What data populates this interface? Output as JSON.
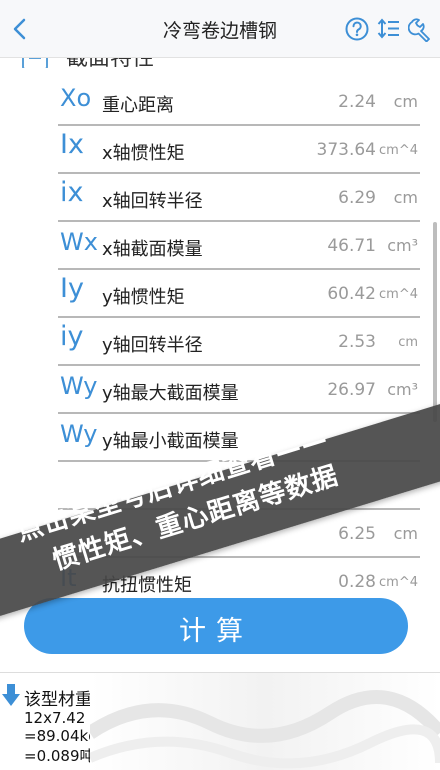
{
  "header": {
    "title": "冷弯卷边槽钢"
  },
  "section": {
    "label": "截面特性"
  },
  "properties": [
    {
      "symbol": "Xo",
      "label": "重心距离",
      "value": "2.24",
      "unit": "cm"
    },
    {
      "symbol": "Ix",
      "label": "x轴惯性矩",
      "value": "373.64",
      "unit": "cm^4"
    },
    {
      "symbol": "ix",
      "label": "x轴回转半径",
      "value": "6.29",
      "unit": "cm"
    },
    {
      "symbol": "Wx",
      "label": "x轴截面模量",
      "value": "46.71",
      "unit": "cm³"
    },
    {
      "symbol": "Iy",
      "label": "y轴惯性矩",
      "value": "60.42",
      "unit": "cm^4"
    },
    {
      "symbol": "iy",
      "label": "y轴回转半径",
      "value": "2.53",
      "unit": "cm"
    },
    {
      "symbol": "Wy",
      "label": "y轴最大截面模量",
      "value": "26.97",
      "unit": "cm³"
    },
    {
      "symbol": "Wy",
      "label": "y轴最小截面模量",
      "value": "",
      "unit": ""
    },
    {
      "symbol": "",
      "label": "",
      "value": "",
      "unit": ""
    },
    {
      "symbol": "",
      "label": "",
      "value": "6.25",
      "unit": "cm"
    },
    {
      "symbol": "It",
      "label": "抗扭惯性矩",
      "value": "0.28",
      "unit": "cm^4"
    }
  ],
  "calculate_button": "计算",
  "result": {
    "line0": "该型材重量",
    "line1": "12x7.42",
    "line2": "=89.04kg",
    "line3": "=0.089吨"
  },
  "banner": {
    "line1": "点击某型号后详细查看——",
    "line2": "惯性矩、重心距离等数据"
  },
  "colors": {
    "accent": "#3d9ae8",
    "symbol": "#3d8fd6",
    "banner": "#464646"
  },
  "icons": [
    "back-chevron-icon",
    "help-icon",
    "sort-icon",
    "tools-icon",
    "down-arrow-icon"
  ]
}
